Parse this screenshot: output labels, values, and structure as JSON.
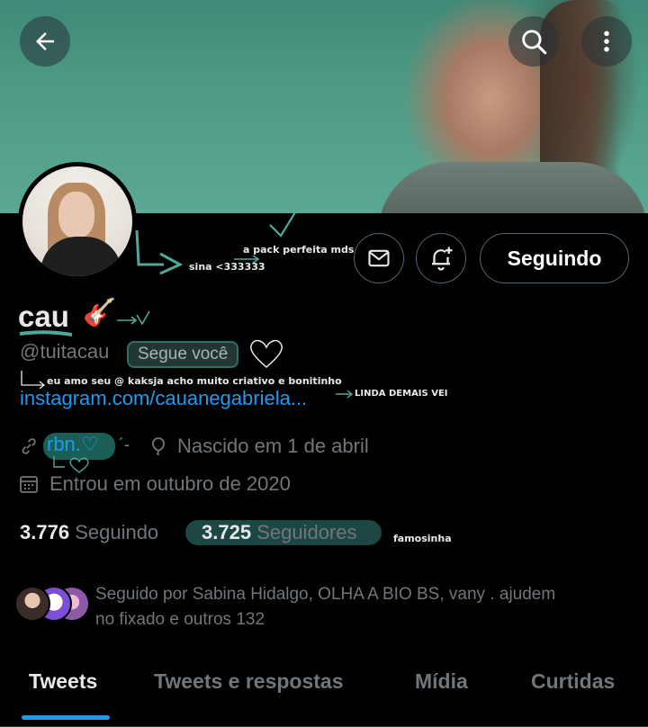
{
  "header": {
    "back_icon": "arrow-left-icon",
    "search_icon": "search-icon",
    "more_icon": "more-vertical-icon"
  },
  "profile": {
    "display_name": "cau",
    "name_emoji": "🎸",
    "handle": "@tuitacau",
    "follows_you": "Segue você",
    "bio_note": "eu amo seu @ kaksja acho muito criativo e bonitinho",
    "link": "instagram.com/cauanegabriela...",
    "link_note": "LINDA DEMAIS VEI",
    "website": "rbn.",
    "website_heart": "♡",
    "birthday": "Nascido em 1 de abril",
    "joined": "Entrou em outubro de 2020"
  },
  "annotations": {
    "pack_note": "a pack perfeita mds",
    "avatar_note": "sina <333333",
    "followers_note": "famosinha"
  },
  "actions": {
    "message_icon": "envelope-icon",
    "notify_icon": "bell-plus-icon",
    "following_label": "Seguindo"
  },
  "stats": {
    "following_count": "3.776",
    "following_label": "Seguindo",
    "followers_count": "3.725",
    "followers_label": "Seguidores"
  },
  "followed_by": {
    "line1": "Seguido por Sabina Hidalgo, OLHA A BIO BS, vany . ajudem",
    "line2": "no fixado e outros 132"
  },
  "tabs": [
    {
      "label": "Tweets",
      "active": true
    },
    {
      "label": "Tweets e respostas",
      "active": false
    },
    {
      "label": "Mídia",
      "active": false
    },
    {
      "label": "Curtidas",
      "active": false
    }
  ],
  "colors": {
    "accent": "#1d9bf0",
    "highlight": "#2f6f66",
    "background": "#000000"
  }
}
